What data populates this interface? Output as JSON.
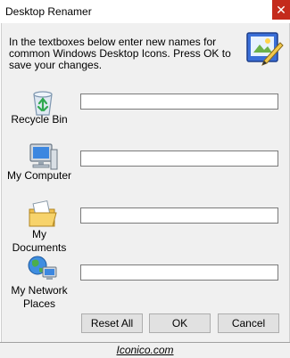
{
  "window": {
    "title": "Desktop Renamer",
    "close_glyph": "✕",
    "accent_close": "#c42b1c"
  },
  "instructions": "In the textboxes below enter new names for common Windows Desktop Icons. Press OK to save your changes.",
  "header_icon": "desktop-renamer-app-icon",
  "rows": [
    {
      "label": "Recycle Bin",
      "icon": "recycle-bin-icon",
      "value": ""
    },
    {
      "label": "My Computer",
      "icon": "my-computer-icon",
      "value": ""
    },
    {
      "label": "My Documents",
      "icon": "my-documents-icon",
      "value": ""
    },
    {
      "label": "My Network\nPlaces",
      "icon": "my-network-places-icon",
      "value": ""
    }
  ],
  "buttons": {
    "reset_all": "Reset All",
    "ok": "OK",
    "cancel": "Cancel"
  },
  "footer": {
    "link": "Iconico.com"
  }
}
